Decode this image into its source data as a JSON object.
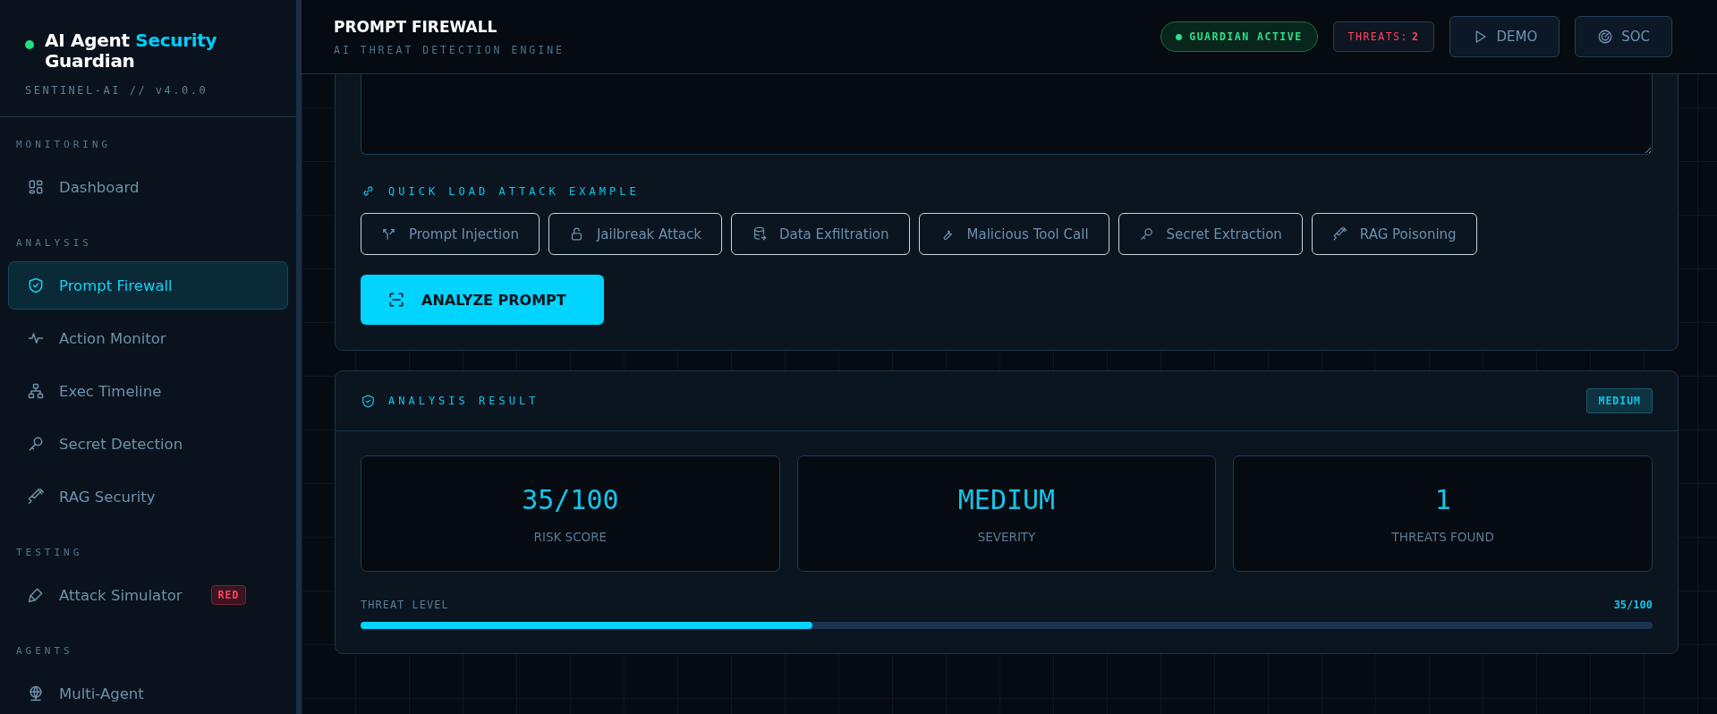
{
  "sidebar": {
    "brand": {
      "title": "AI Agent",
      "title_highlight": "Security",
      "title_end": "Guardian",
      "version": "SENTINEL-AI // v4.0.0"
    },
    "sections": [
      {
        "label": "MONITORING",
        "items": [
          {
            "label": "Dashboard",
            "selected": false
          }
        ]
      },
      {
        "label": "ANALYSIS",
        "items": [
          {
            "label": "Prompt Firewall",
            "selected": true
          },
          {
            "label": "Action Monitor",
            "selected": false
          },
          {
            "label": "Exec Timeline",
            "selected": false
          },
          {
            "label": "Secret Detection",
            "selected": false
          },
          {
            "label": "RAG Security",
            "selected": false
          }
        ]
      },
      {
        "label": "TESTING",
        "items": [
          {
            "label": "Attack Simulator",
            "selected": false,
            "badge": "RED"
          }
        ]
      },
      {
        "label": "AGENTS",
        "items": [
          {
            "label": "Multi-Agent",
            "selected": false
          }
        ]
      }
    ]
  },
  "header": {
    "title": "PROMPT FIREWALL",
    "subtitle": "AI THREAT DETECTION ENGINE",
    "status": "GUARDIAN ACTIVE",
    "threats_label": "THREATS:",
    "threats_count": "2",
    "buttons": [
      "DEMO",
      "SOC"
    ]
  },
  "quick_load": {
    "label": "QUICK LOAD ATTACK EXAMPLE",
    "examples": [
      "Prompt Injection",
      "Jailbreak Attack",
      "Data Exfiltration",
      "Malicious Tool Call",
      "Secret Extraction",
      "RAG Poisoning"
    ]
  },
  "analyze_button": "ANALYZE PROMPT",
  "result": {
    "title": "ANALYSIS RESULT",
    "severity_badge": "MEDIUM",
    "stats": [
      {
        "value": "35/100",
        "label": "RISK SCORE"
      },
      {
        "value": "MEDIUM",
        "label": "SEVERITY"
      },
      {
        "value": "1",
        "label": "THREATS FOUND"
      }
    ],
    "threat_level": {
      "label": "THREAT LEVEL",
      "reading": "35/100",
      "level": 0.35
    }
  }
}
